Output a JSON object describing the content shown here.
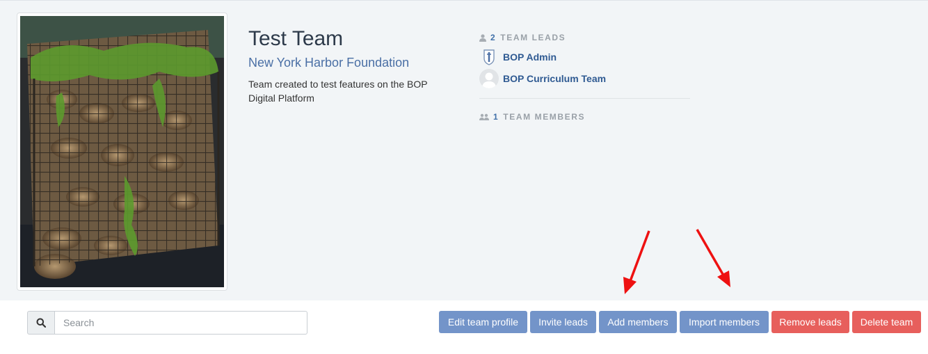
{
  "team": {
    "title": "Test Team",
    "organization": "New York Harbor Foundation",
    "description": "Team created to test features on the BOP Digital Platform"
  },
  "leads": {
    "count": "2",
    "label": "TEAM LEADS",
    "items": [
      {
        "name": "BOP Admin",
        "avatar": "shield-avatar-icon"
      },
      {
        "name": "BOP Curriculum Team",
        "avatar": "default-avatar-icon"
      }
    ]
  },
  "members": {
    "count": "1",
    "label": "TEAM MEMBERS"
  },
  "search": {
    "placeholder": "Search"
  },
  "actions": {
    "edit_profile": "Edit team profile",
    "invite_leads": "Invite leads",
    "add_members": "Add members",
    "import_members": "Import members",
    "remove_leads": "Remove leads",
    "delete_team": "Delete team"
  },
  "colors": {
    "primary_button": "#7394c9",
    "danger_button": "#e75f5c",
    "annotation_arrow": "#ee1111"
  }
}
